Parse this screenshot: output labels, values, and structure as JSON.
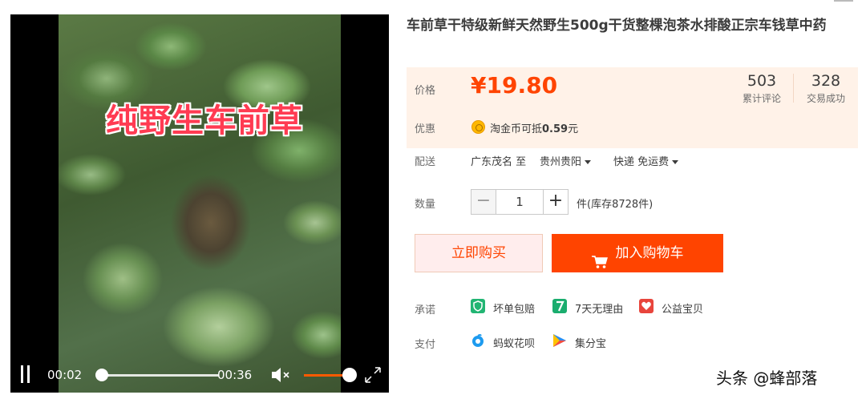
{
  "video": {
    "caption": "纯野生车前草",
    "current_time": "00:02",
    "total_time": "00:36",
    "progress": 0.06,
    "volume": 1.0,
    "muted": false
  },
  "product": {
    "title": "车前草干特级新鲜天然野生500g干货整棵泡茶水排酸正宗车钱草中药"
  },
  "price": {
    "label": "价格",
    "value": "¥19.80",
    "reviews_count": "503",
    "reviews_label": "累计评论",
    "sales_count": "328",
    "sales_label": "交易成功",
    "promo_label": "优惠",
    "promo_text_prefix": "淘金币可抵",
    "promo_amount": "0.59",
    "promo_unit": "元"
  },
  "shipping": {
    "label": "配送",
    "from": "广东茂名 至",
    "to": "贵州贵阳",
    "method": "快递 免运费"
  },
  "quantity": {
    "label": "数量",
    "minus": "−",
    "plus": "+",
    "value": "1",
    "stock": "件(库存8728件)"
  },
  "actions": {
    "buy_now": "立即购买",
    "add_to_cart": "加入购物车"
  },
  "promise": {
    "label": "承诺",
    "items": [
      "坏单包赔",
      "7天无理由",
      "公益宝贝"
    ]
  },
  "payment": {
    "label": "支付",
    "items": [
      "蚂蚁花呗",
      "集分宝"
    ]
  },
  "watermark": "头条 @蜂部落",
  "colors": {
    "accent": "#ff4400",
    "price_panel_bg": "#fff2e8",
    "buy_now_bg": "#ffeded",
    "caption": "#ff3b52"
  }
}
